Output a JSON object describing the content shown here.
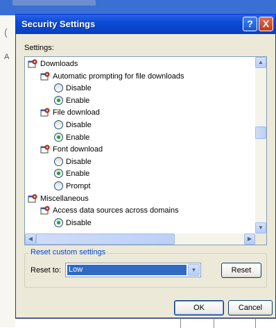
{
  "dialog": {
    "title": "Security Settings",
    "help_glyph": "?",
    "close_glyph": "X"
  },
  "settings_label": "Settings:",
  "list": {
    "items": [
      {
        "kind": "category",
        "label": "Downloads",
        "icon": "gear-sheet-icon"
      },
      {
        "kind": "setting",
        "label": "Automatic prompting for file downloads",
        "icon": "gear-sheet-icon"
      },
      {
        "kind": "option",
        "label": "Disable",
        "checked": false
      },
      {
        "kind": "option",
        "label": "Enable",
        "checked": true
      },
      {
        "kind": "setting",
        "label": "File download",
        "icon": "gear-sheet-icon"
      },
      {
        "kind": "option",
        "label": "Disable",
        "checked": false
      },
      {
        "kind": "option",
        "label": "Enable",
        "checked": true
      },
      {
        "kind": "setting",
        "label": "Font download",
        "icon": "gear-sheet-icon"
      },
      {
        "kind": "option",
        "label": "Disable",
        "checked": false
      },
      {
        "kind": "option",
        "label": "Enable",
        "checked": true
      },
      {
        "kind": "option",
        "label": "Prompt",
        "checked": false
      },
      {
        "kind": "category",
        "label": "Miscellaneous",
        "icon": "gear-sheet-icon"
      },
      {
        "kind": "setting",
        "label": "Access data sources across domains",
        "icon": "gear-sheet-icon"
      },
      {
        "kind": "option",
        "label": "Disable",
        "checked": true
      }
    ]
  },
  "reset_group": {
    "legend": "Reset custom settings",
    "label": "Reset to:",
    "selected": "Low",
    "reset_button": "Reset"
  },
  "footer": {
    "ok_button": "OK",
    "cancel_button": "Cancel"
  },
  "colors": {
    "title_bar": "#0a4bd6",
    "selection": "#316ac5",
    "group_legend": "#0046d5",
    "radio_dot": "#21a121"
  }
}
